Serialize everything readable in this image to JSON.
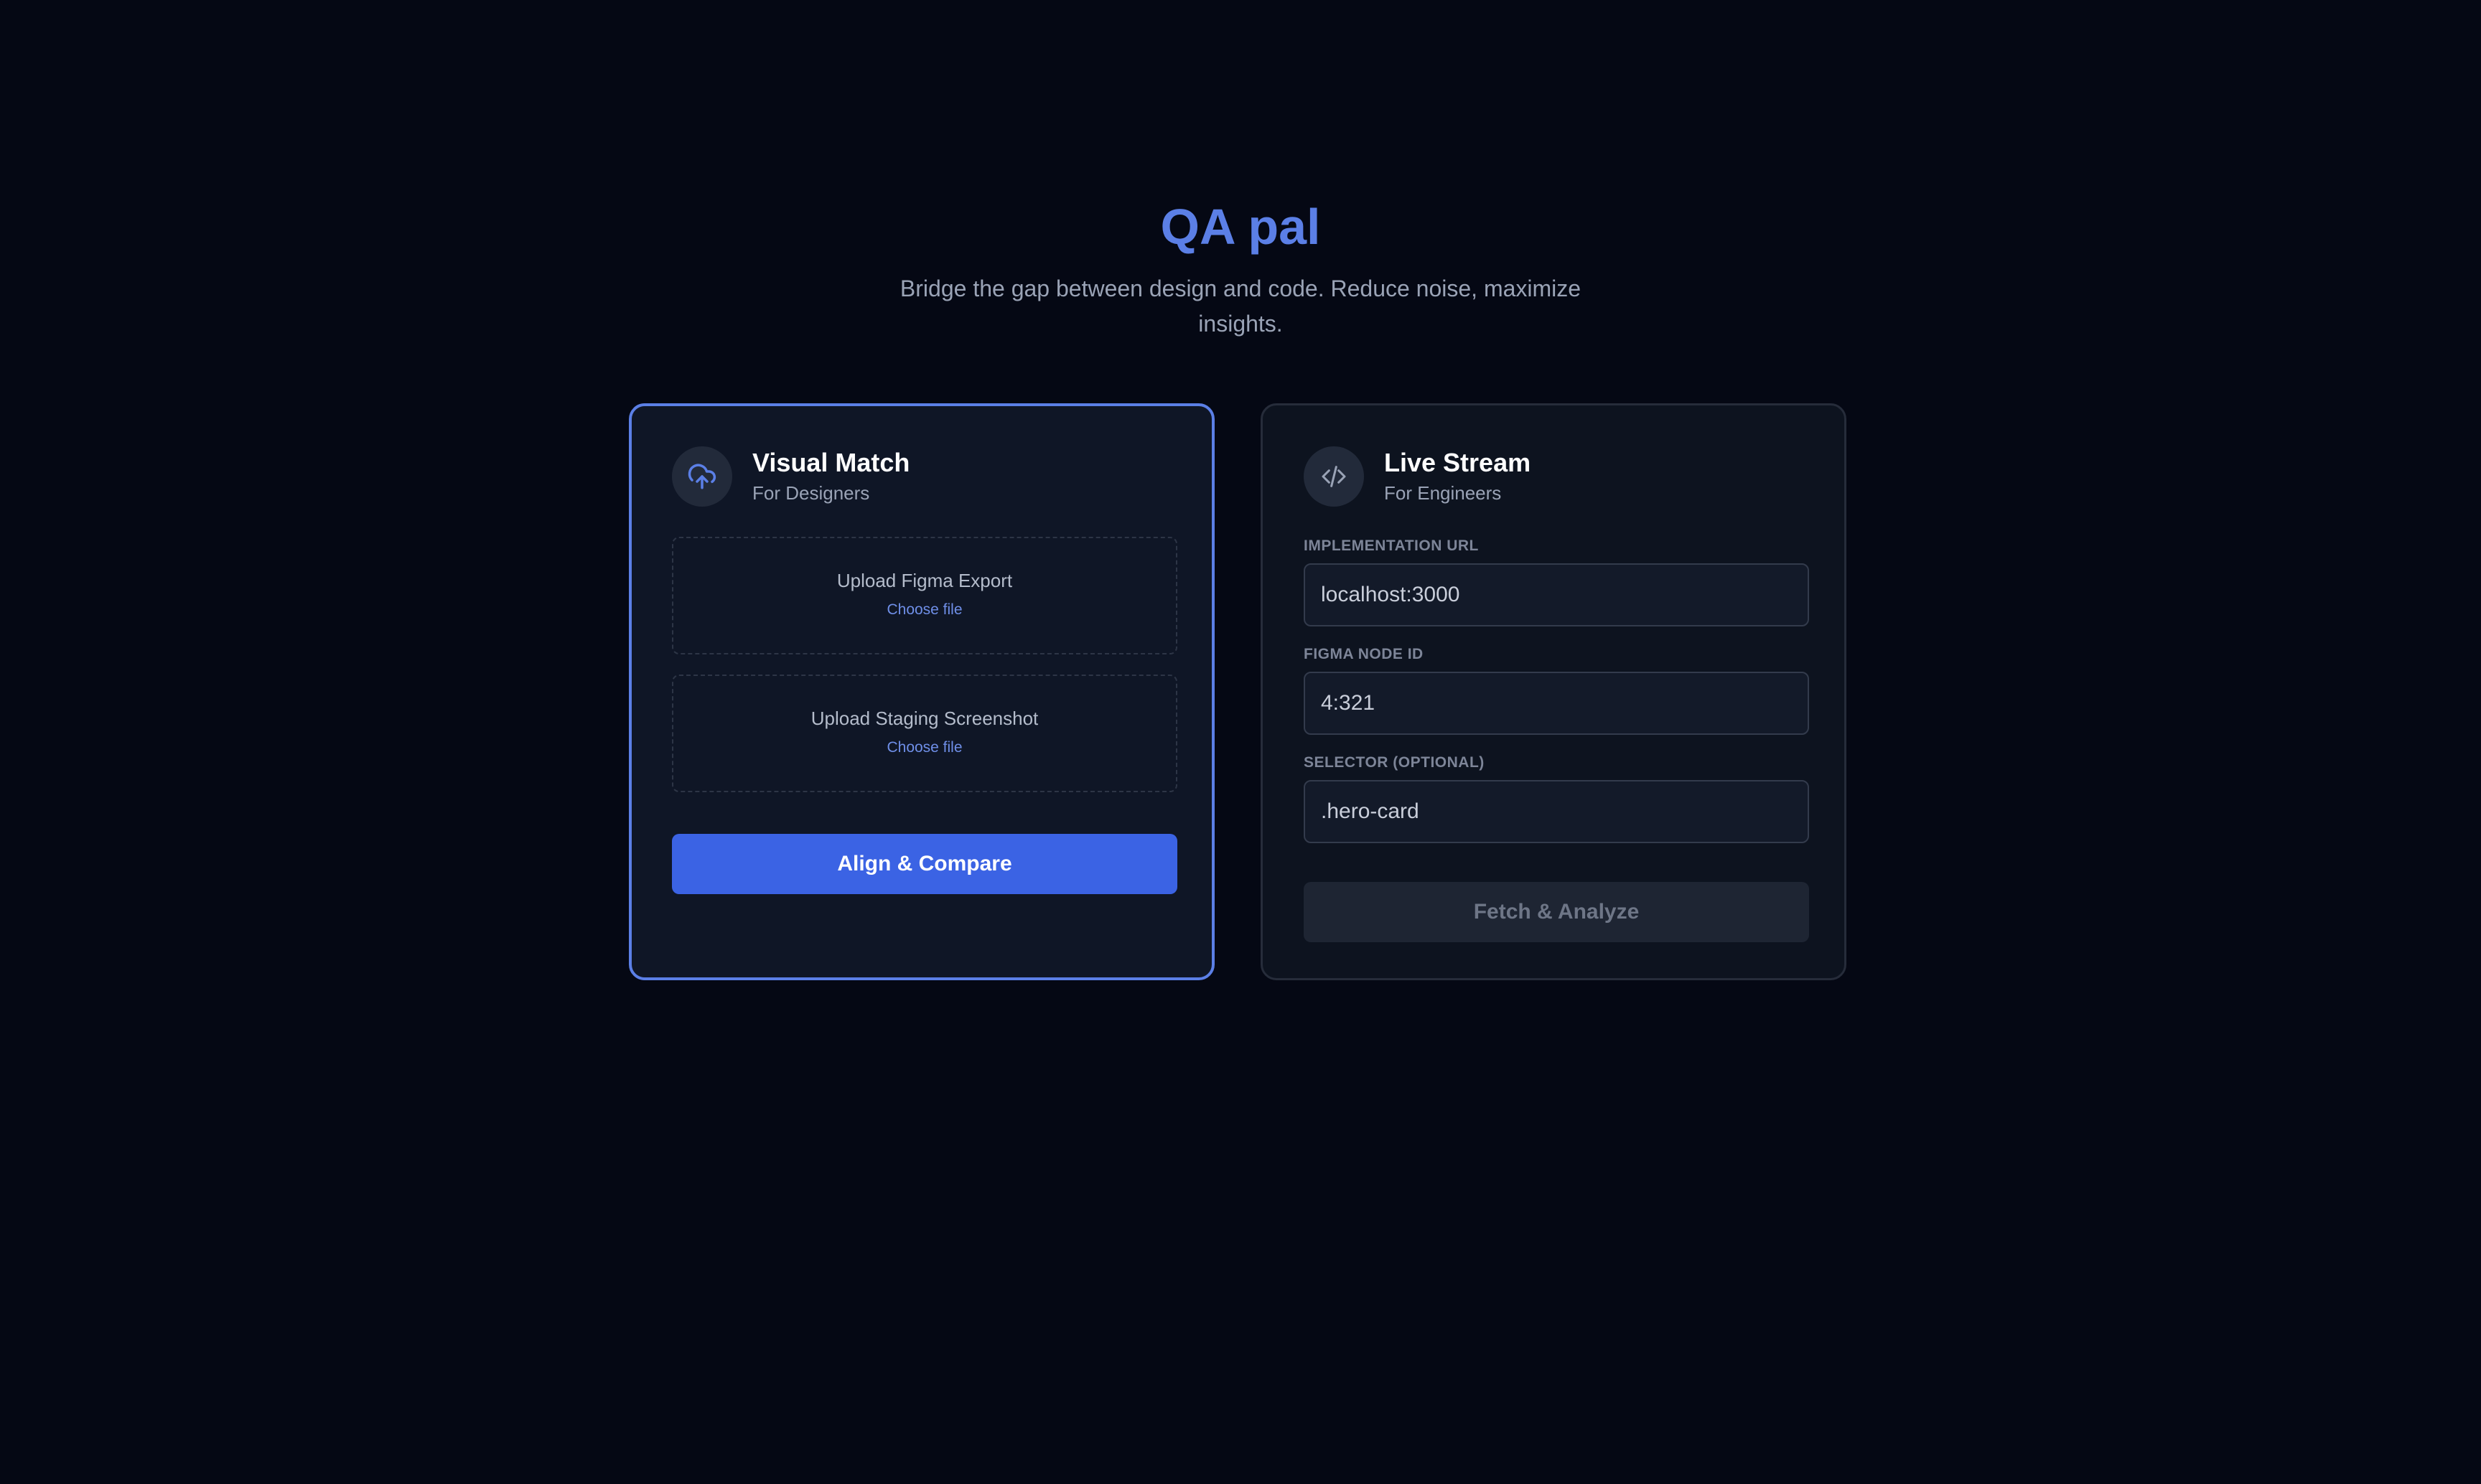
{
  "app": {
    "title": "QA pal",
    "subtitle": "Bridge the gap between design and code. Reduce noise, maximize insights."
  },
  "colors": {
    "background": "#050814",
    "accent": "#5b7fe6",
    "primary_button": "#3b63e4"
  },
  "visual_match": {
    "icon": "cloud-upload-icon",
    "title": "Visual Match",
    "subtitle": "For Designers",
    "uploads": [
      {
        "label": "Upload Figma Export",
        "link": "Choose file"
      },
      {
        "label": "Upload Staging Screenshot",
        "link": "Choose file"
      }
    ],
    "button_label": "Align & Compare"
  },
  "live_stream": {
    "icon": "code-icon",
    "title": "Live Stream",
    "subtitle": "For Engineers",
    "fields": [
      {
        "label": "IMPLEMENTATION URL",
        "value": "localhost:3000"
      },
      {
        "label": "FIGMA NODE ID",
        "value": "4:321"
      },
      {
        "label": "SELECTOR (OPTIONAL)",
        "value": ".hero-card"
      }
    ],
    "button_label": "Fetch & Analyze",
    "button_disabled": true
  }
}
